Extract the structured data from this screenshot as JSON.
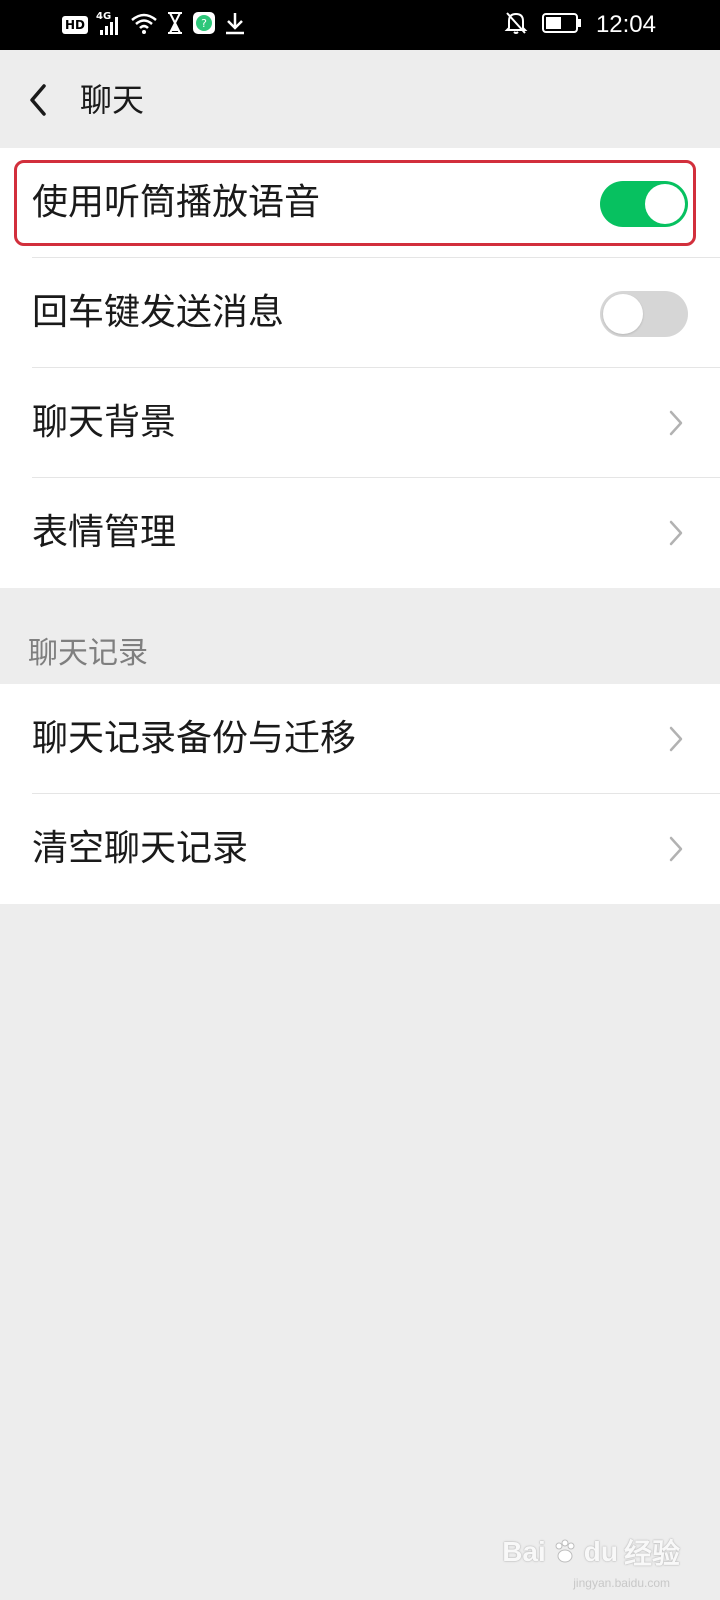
{
  "status_bar": {
    "badge": "HD",
    "network": "4G",
    "time": "12:04"
  },
  "header": {
    "title": "聊天"
  },
  "section1": {
    "items": [
      {
        "label": "使用听筒播放语音",
        "control": "toggle",
        "on": true
      },
      {
        "label": "回车键发送消息",
        "control": "toggle",
        "on": false
      },
      {
        "label": "聊天背景",
        "control": "chevron"
      },
      {
        "label": "表情管理",
        "control": "chevron"
      }
    ]
  },
  "section2": {
    "title": "聊天记录",
    "items": [
      {
        "label": "聊天记录备份与迁移",
        "control": "chevron"
      },
      {
        "label": "清空聊天记录",
        "control": "chevron"
      }
    ]
  },
  "colors": {
    "toggle_on": "#07c160",
    "toggle_off": "#d6d6d6",
    "highlight": "#d22f3c",
    "background": "#ededed"
  },
  "watermark": {
    "text": "Bai",
    "text2": "du",
    "suffix": "经验",
    "sub": "jingyan.baidu.com"
  }
}
